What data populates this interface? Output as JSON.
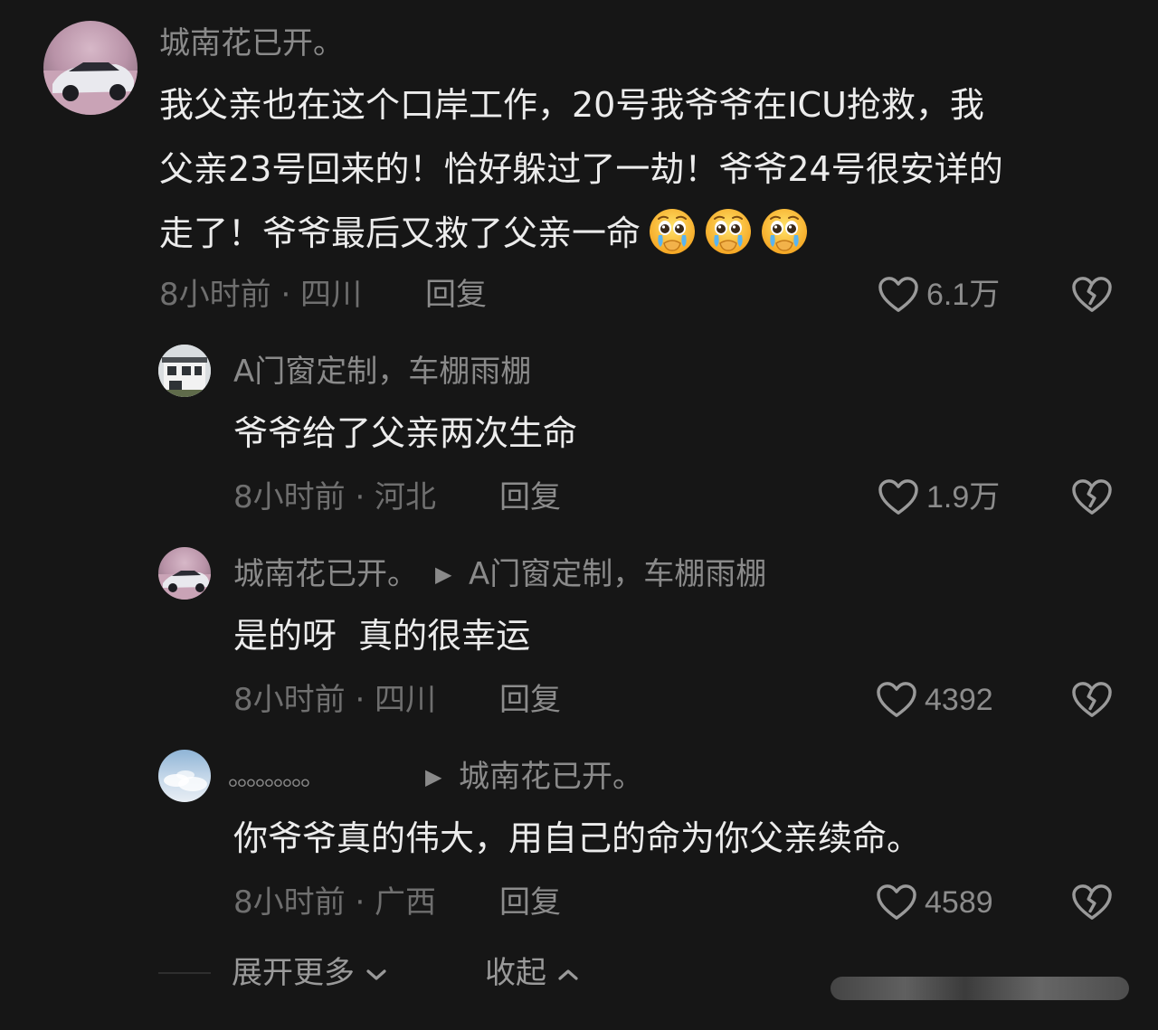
{
  "comment": {
    "username": "城南花已开。",
    "lines": [
      "我父亲也在这个口岸工作，20号我爷爷在ICU抢救，我",
      "父亲23号回来的！恰好躲过了一劫！爷爷24号很安详的",
      "走了！爷爷最后又救了父亲一命"
    ],
    "emoji_icon": "crying-face-icon",
    "meta": "8小时前 · 四川",
    "reply_label": "回复",
    "likes": "6.1万"
  },
  "replies": [
    {
      "username": "A门窗定制，车棚雨棚",
      "reply_to": "",
      "text": "爷爷给了父亲两次生命",
      "meta": "8小时前 · 河北",
      "reply_label": "回复",
      "likes": "1.9万"
    },
    {
      "username": "城南花已开。",
      "reply_to": "A门窗定制，车棚雨棚",
      "text": "是的呀  真的很幸运",
      "meta": "8小时前 · 四川",
      "reply_label": "回复",
      "likes": "4392"
    },
    {
      "username": "。。。。。。。。。",
      "reply_to": "城南花已开。",
      "text": "你爷爷真的伟大，用自己的命为你父亲续命。",
      "meta": "8小时前 · 广西",
      "reply_label": "回复",
      "likes": "4589"
    }
  ],
  "footer": {
    "expand_label": "展开更多",
    "collapse_label": "收起"
  },
  "icons": {
    "like": "heart-outline-icon",
    "dislike": "broken-heart-icon",
    "reply_arrow": "triangle-right-icon",
    "expand": "chevron-down-icon",
    "collapse": "chevron-up-icon"
  },
  "colors": {
    "background": "#161616",
    "text": "#ececec",
    "muted": "#8a8a8a",
    "meta": "#6f6f6f"
  }
}
